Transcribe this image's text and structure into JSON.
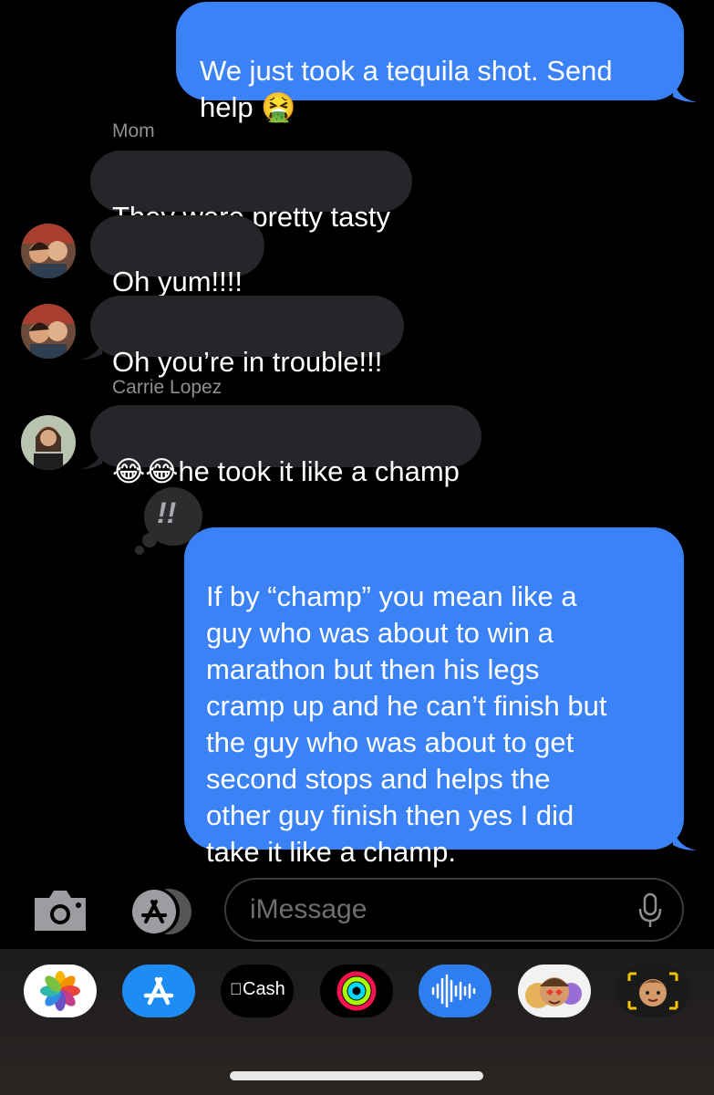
{
  "messages": {
    "m1": "We just took a tequila shot. Send help 🤮",
    "sender_mom": "Mom",
    "m2": "They were pretty tasty",
    "m3": "Oh yum!!!!",
    "m4": "Oh you’re in trouble!!!",
    "sender_carrie": "Carrie Lopez",
    "m5": "😂😂he took it like a champ",
    "m6": "If by “champ” you mean like a\nguy who was about to win a\nmarathon but then his legs\ncramp up and he can’t finish but\nthe guy who was about to get\nsecond stops and helps the\nother guy finish then yes I did\ntake it like a champ.",
    "tapback": "!!"
  },
  "input": {
    "placeholder": "iMessage"
  },
  "apps": {
    "cash_label": "Cash",
    "cash_glyph": ""
  },
  "colors": {
    "sent": "#3b82f6",
    "received": "#26262a",
    "background": "#000000"
  }
}
